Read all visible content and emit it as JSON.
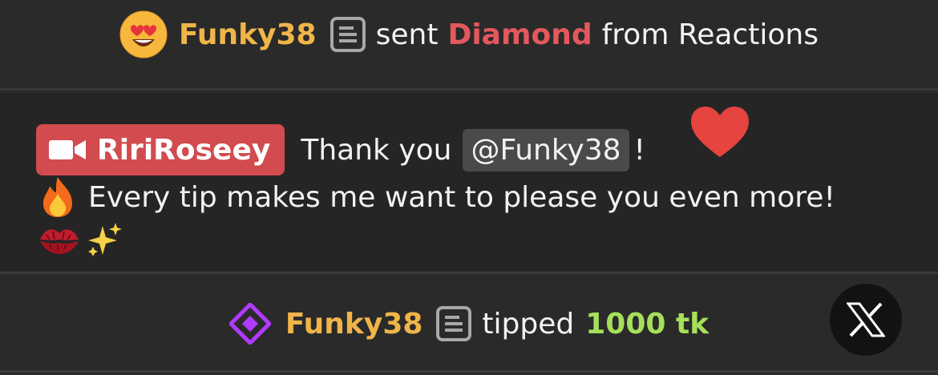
{
  "reaction_notice": {
    "emoji": "heart-eyes-emoji",
    "username": "Funky38",
    "verb": "sent",
    "gift": "Diamond",
    "suffix": "from Reactions"
  },
  "broadcaster_message": {
    "badge_username": "RiriRoseey",
    "text_before_mention": "Thank you",
    "mention": "@Funky38",
    "text_after_mention": "!",
    "line2": "Every tip makes me want to please you even more!",
    "emojis": [
      "fire-emoji",
      "kiss-mark-emoji",
      "sparkles-emoji",
      "red-heart-emoji"
    ]
  },
  "tip_notice": {
    "username": "Funky38",
    "verb": "tipped",
    "amount": "1000 tk"
  },
  "colors": {
    "username": "#f0b549",
    "gift": "#e3585c",
    "tip_amount": "#a6e05a",
    "broadcaster_badge": "#d14b4f",
    "background": "#2a2a2a"
  }
}
